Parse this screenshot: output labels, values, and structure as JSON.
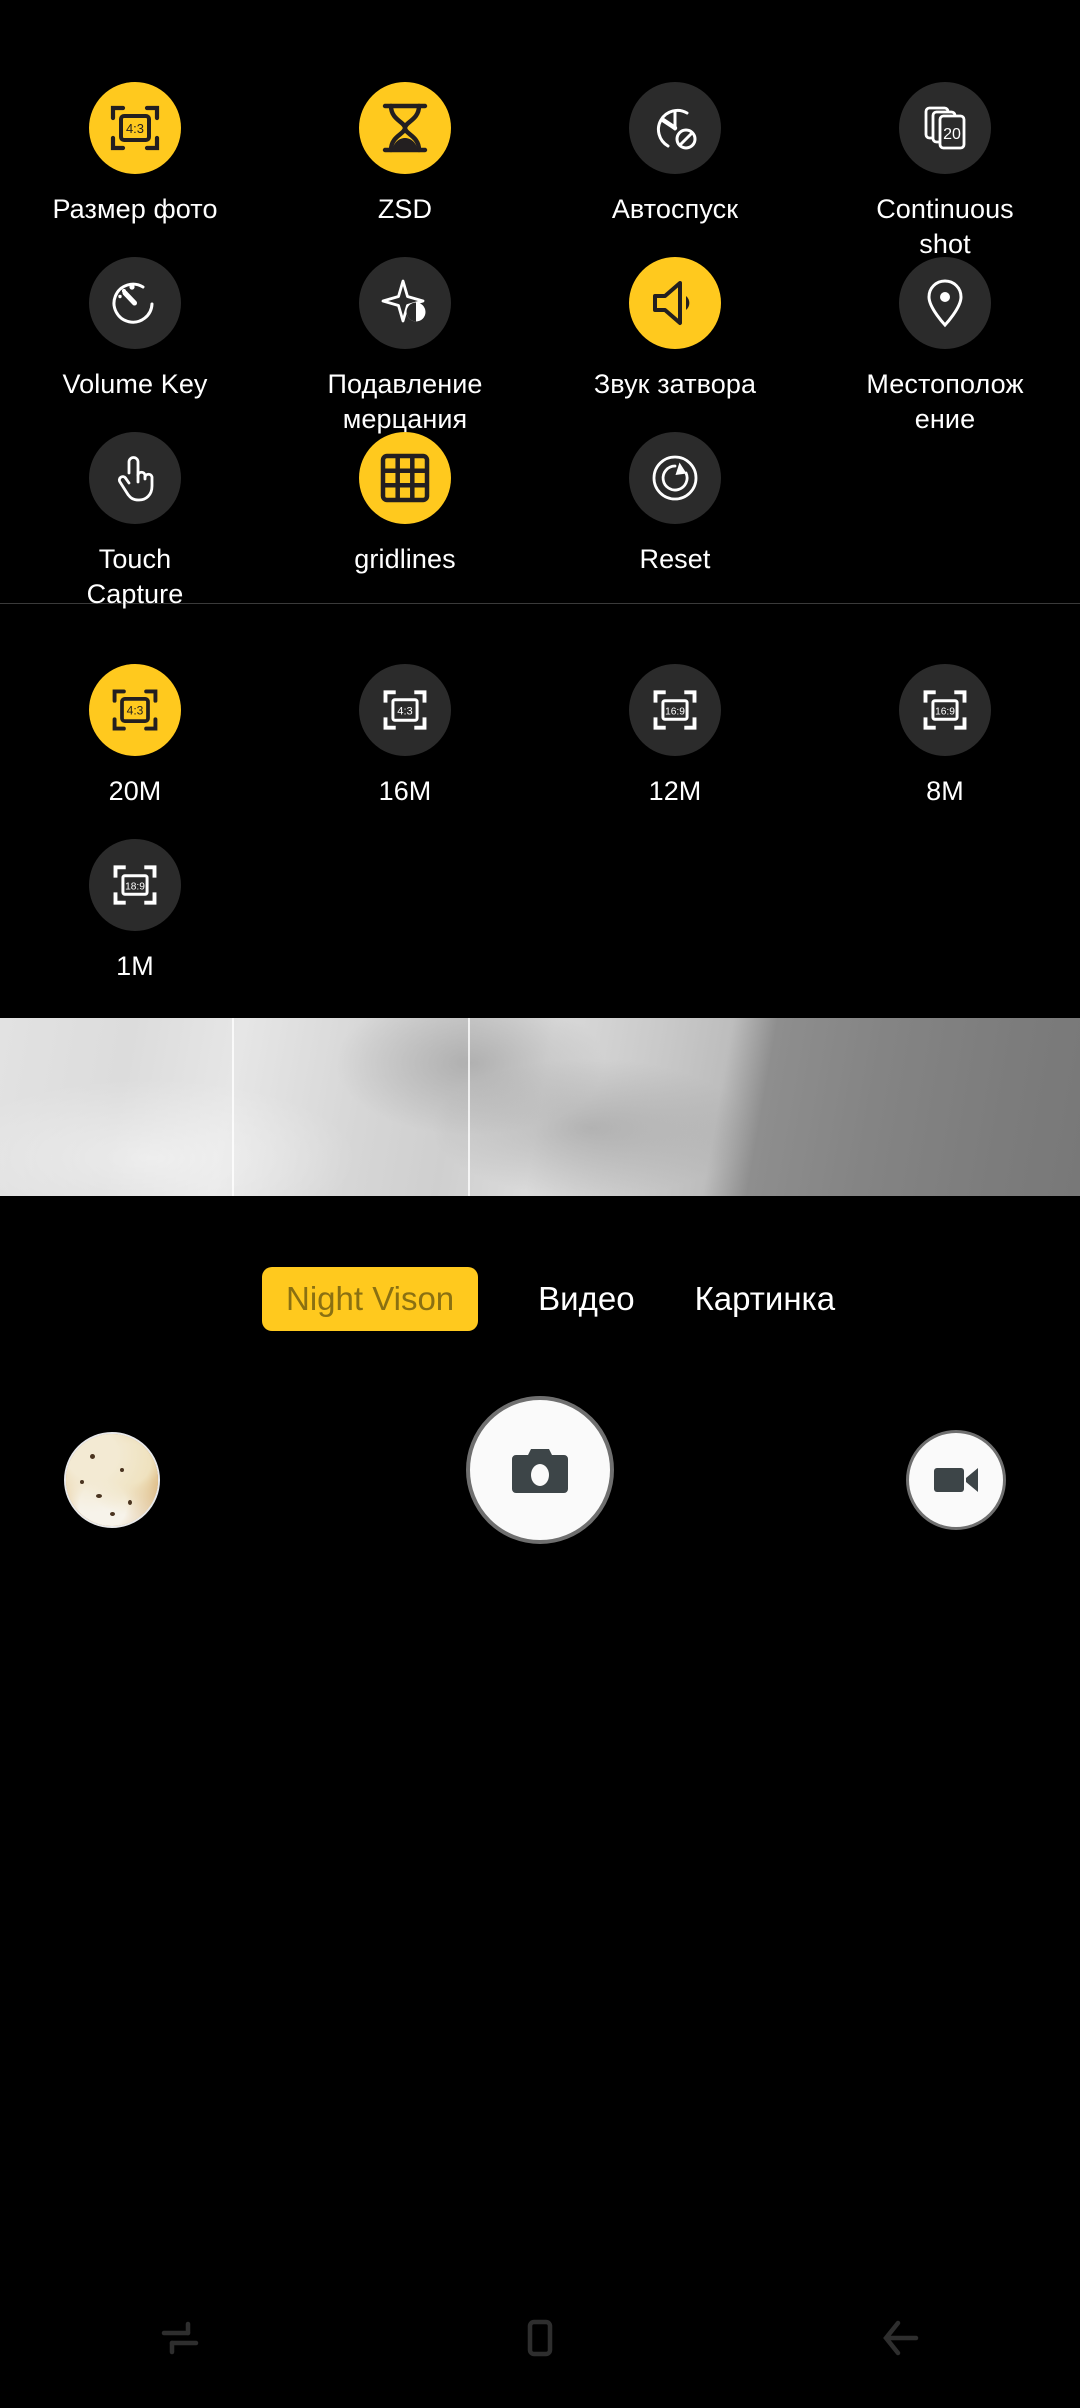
{
  "theme": {
    "background": "#000000",
    "accent": "#FFC91E",
    "bubble_off": "#2b2b2b",
    "text": "#ffffff",
    "divider": "#3a3a3a",
    "active_mode_text": "#8a7012"
  },
  "settings": {
    "items": [
      {
        "label": "Размер фото",
        "icon": "photo-size-icon",
        "badge": "4:3",
        "active": true
      },
      {
        "label": "ZSD",
        "icon": "hourglass-icon",
        "badge": "",
        "active": true
      },
      {
        "label": "Автоспуск",
        "icon": "self-timer-off-icon",
        "badge": "",
        "active": false
      },
      {
        "label": "Continuous\nshot",
        "icon": "continuous-shot-icon",
        "badge": "20",
        "active": false
      },
      {
        "label": "Volume Key",
        "icon": "volume-key-timer-icon",
        "badge": "",
        "active": false
      },
      {
        "label": "Подавление\nмерцания",
        "icon": "anti-flicker-icon",
        "badge": "",
        "active": false
      },
      {
        "label": "Звук затвора",
        "icon": "shutter-sound-icon",
        "badge": "",
        "active": true
      },
      {
        "label": "Местополож\nение",
        "icon": "location-pin-icon",
        "badge": "",
        "active": false
      },
      {
        "label": "Touch\nCapture",
        "icon": "touch-capture-icon",
        "badge": "",
        "active": false
      },
      {
        "label": "gridlines",
        "icon": "gridlines-icon",
        "badge": "",
        "active": true
      },
      {
        "label": "Reset",
        "icon": "reset-icon",
        "badge": "",
        "active": false
      }
    ]
  },
  "resolutions": {
    "items": [
      {
        "label": "20M",
        "ratio": "4:3",
        "active": true
      },
      {
        "label": "16M",
        "ratio": "4:3",
        "active": false
      },
      {
        "label": "12M",
        "ratio": "16:9",
        "active": false
      },
      {
        "label": "8M",
        "ratio": "16:9",
        "active": false
      },
      {
        "label": "1M",
        "ratio": "18:9",
        "active": false
      }
    ]
  },
  "preview": {
    "gridlines_visible": true,
    "description": "grayscale sky preview"
  },
  "modes": {
    "items": [
      {
        "label": "Night Vison",
        "active": true
      },
      {
        "label": "Видео",
        "active": false
      },
      {
        "label": "Картинка",
        "active": false
      }
    ]
  },
  "controls": {
    "gallery_thumb": "gallery-thumbnail",
    "shutter": "camera-shutter-icon",
    "video": "video-record-icon"
  },
  "navbar": {
    "items": [
      {
        "name": "recents",
        "icon": "recent-apps-icon"
      },
      {
        "name": "home",
        "icon": "home-square-icon"
      },
      {
        "name": "back",
        "icon": "back-arrow-icon"
      }
    ]
  }
}
